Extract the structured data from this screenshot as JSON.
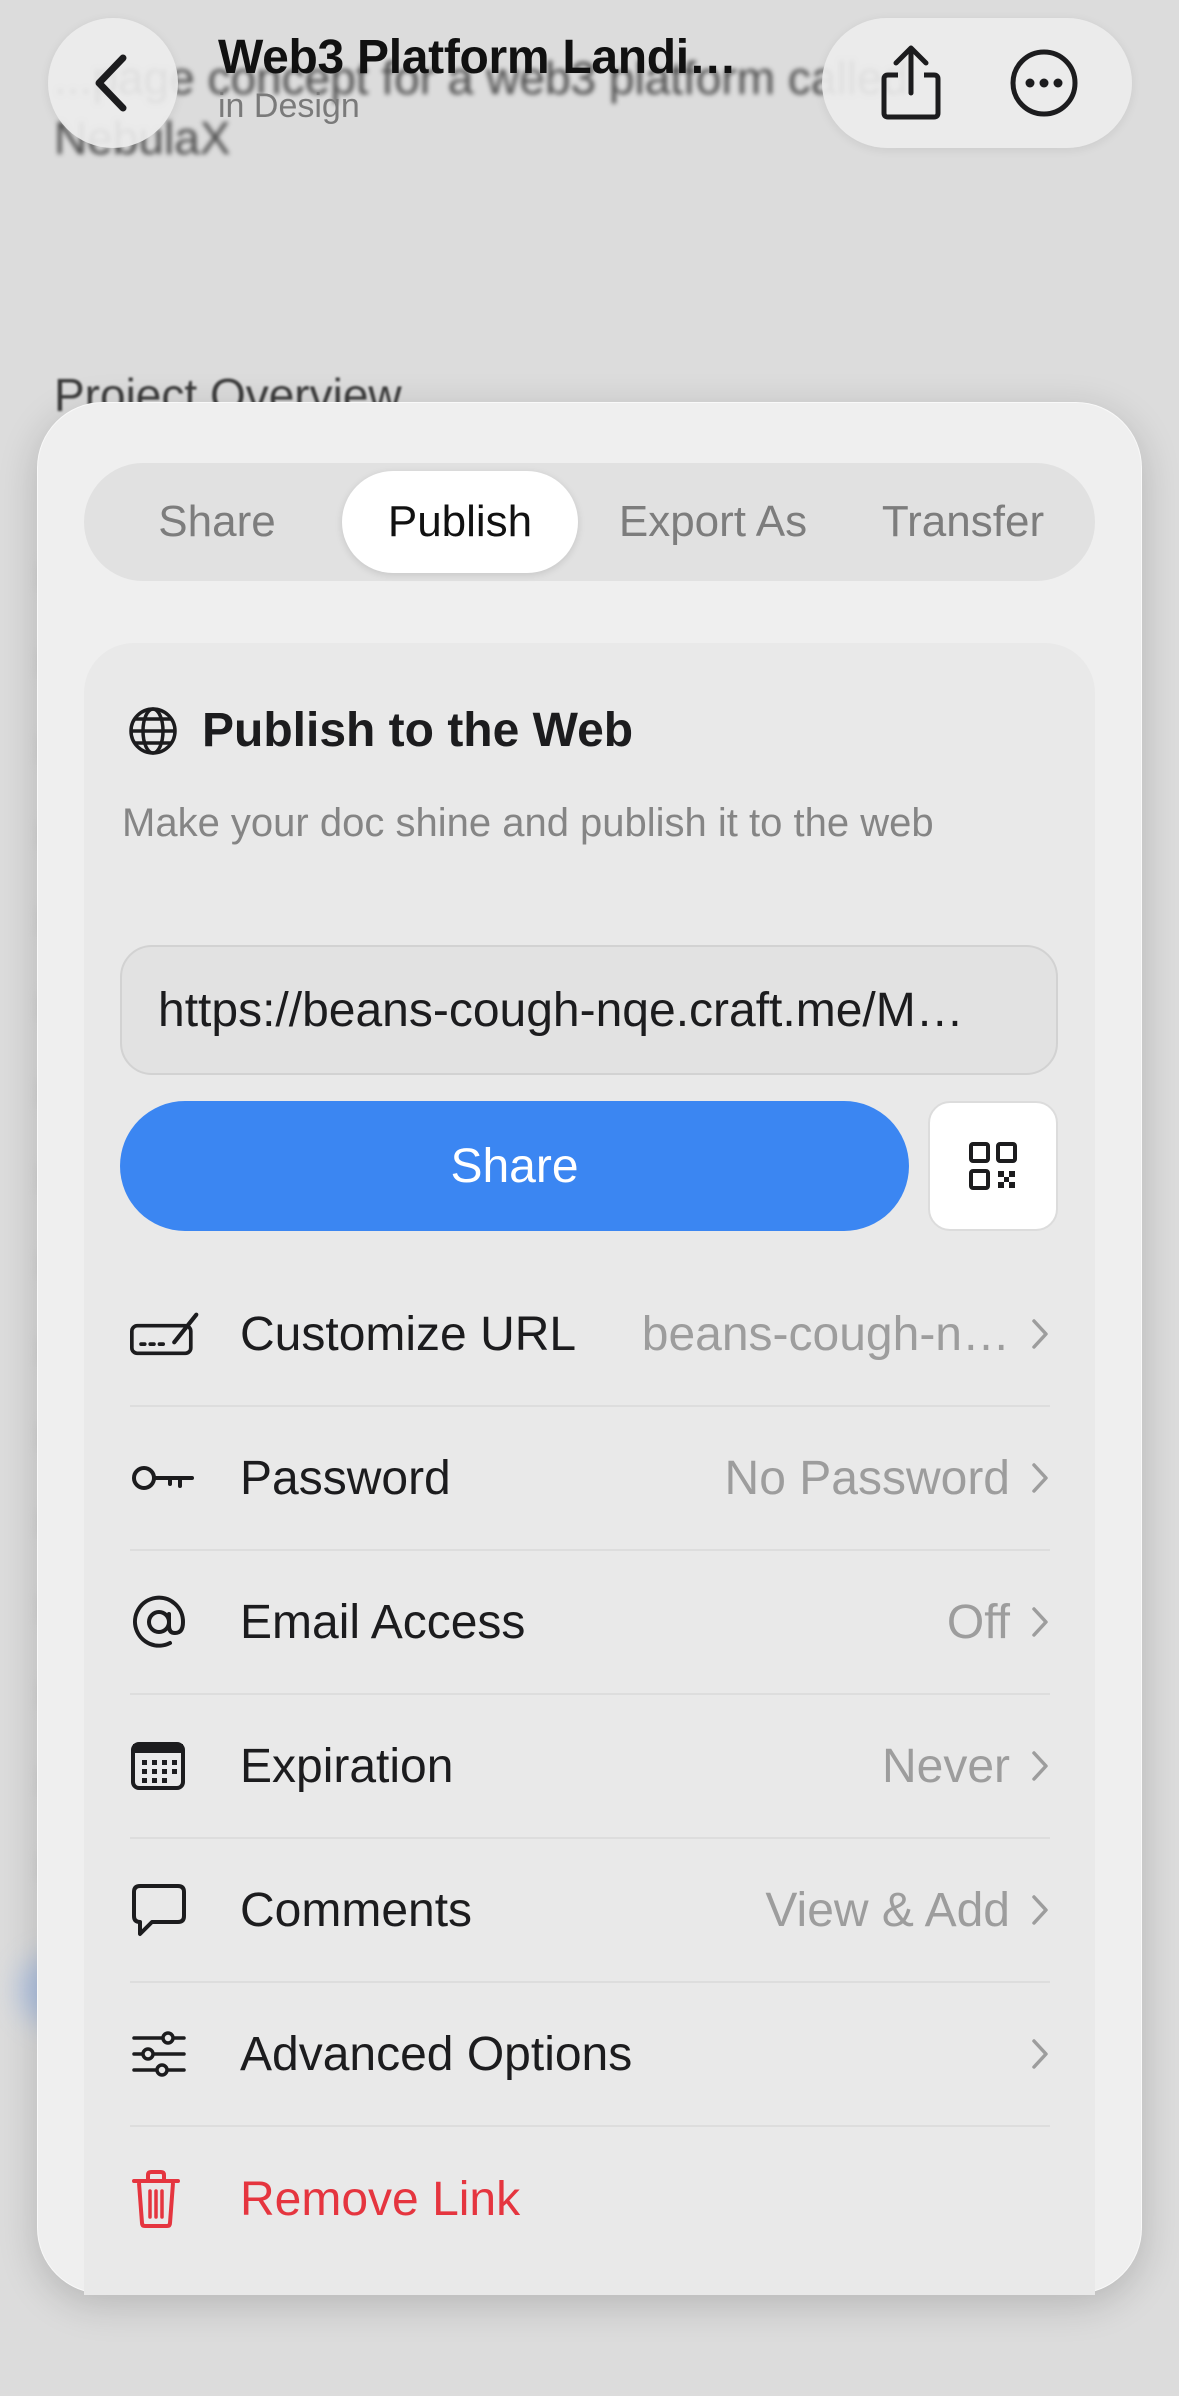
{
  "background": {
    "title": "...page concept for a web3 platform called NebulaX",
    "heading": "Project Overview"
  },
  "nav": {
    "back_icon": "chevron-left-icon",
    "title": "Web3 Platform Landi…",
    "subtitle": "in Design",
    "share_icon": "share-icon",
    "more_icon": "ellipsis-circle-icon"
  },
  "tabs": [
    {
      "label": "Share",
      "selected": false
    },
    {
      "label": "Publish",
      "selected": true
    },
    {
      "label": "Export As",
      "selected": false
    },
    {
      "label": "Transfer",
      "selected": false
    }
  ],
  "publish": {
    "icon": "globe-icon",
    "title": "Publish to the Web",
    "description": "Make your doc shine and publish it to the web",
    "url": "https://beans-cough-nqe.craft.me/M…",
    "share_button": "Share",
    "qr_icon": "qr-code-icon"
  },
  "settings": [
    {
      "icon": "customize-url-icon",
      "label": "Customize URL",
      "value": "beans-cough-n…"
    },
    {
      "icon": "key-icon",
      "label": "Password",
      "value": "No Password"
    },
    {
      "icon": "at-sign-icon",
      "label": "Email Access",
      "value": "Off"
    },
    {
      "icon": "calendar-icon",
      "label": "Expiration",
      "value": "Never"
    },
    {
      "icon": "comment-icon",
      "label": "Comments",
      "value": "View & Add"
    },
    {
      "icon": "sliders-icon",
      "label": "Advanced Options",
      "value": ""
    },
    {
      "icon": "trash-icon",
      "label": "Remove Link",
      "value": ""
    }
  ],
  "colors": {
    "accent": "#3b86f2",
    "danger": "#e5353f",
    "secondary_text": "#9d9d9d"
  }
}
